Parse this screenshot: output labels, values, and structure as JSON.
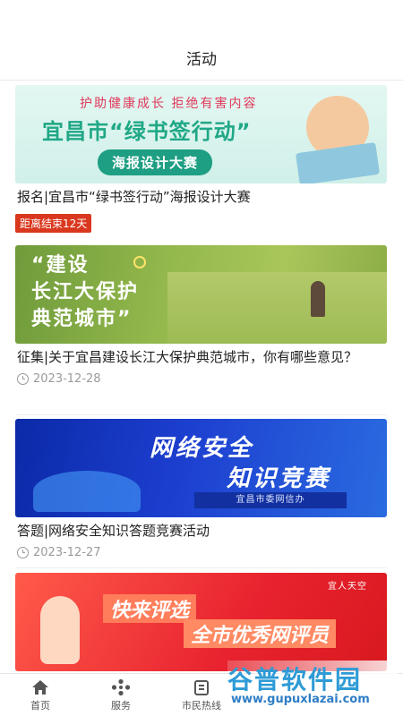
{
  "header": {
    "title": "活动"
  },
  "activities": [
    {
      "banner": {
        "tagline": "护助健康成长  拒绝有害内容",
        "headline": "宜昌市“绿书签行动”",
        "pill": "海报设计大赛"
      },
      "title": "报名|宜昌市“绿书签行动”海报设计大赛",
      "tag": "距离结束12天"
    },
    {
      "banner": {
        "line1": "“建设",
        "line2": "长江大保护",
        "line3": "典范城市”"
      },
      "title": "征集|关于宜昌建设长江大保护典范城市，你有哪些意见？",
      "date": "2023-12-28"
    },
    {
      "banner": {
        "line1": "网络安全",
        "line2": "知识竞赛",
        "org": "宜昌市委网信办"
      },
      "title": "答题|网络安全知识答题竞赛活动",
      "date": "2023-12-27"
    },
    {
      "banner": {
        "badge": "宜人天空",
        "line1": "快来评选",
        "line2": "全市优秀网评员"
      }
    }
  ],
  "tabbar": {
    "items": [
      {
        "label": "首页",
        "icon": "home-icon"
      },
      {
        "label": "服务",
        "icon": "services-icon"
      },
      {
        "label": "市民热线",
        "icon": "hotline-icon"
      }
    ]
  },
  "watermark": {
    "title": "谷普软件园",
    "url": "www.gupuxlazai.com"
  }
}
